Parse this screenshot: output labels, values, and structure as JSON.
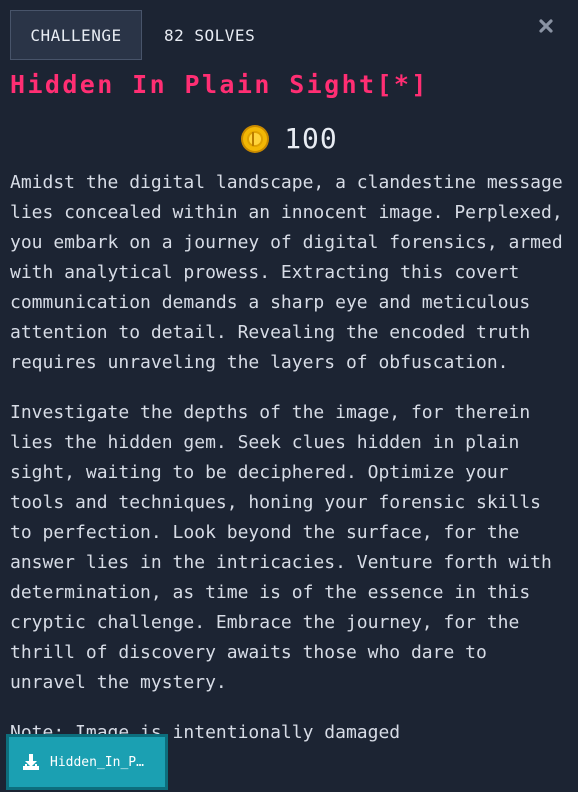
{
  "tabs": {
    "challenge": "CHALLENGE",
    "solves": "82 SOLVES"
  },
  "icons": {
    "close": "close-icon",
    "coin": "coin-icon",
    "download": "download-icon"
  },
  "colors": {
    "background": "#1c2433",
    "title": "#ff2e73",
    "button": "#1ba0b2",
    "coin": "#f2b705"
  },
  "challenge": {
    "title": "Hidden In Plain Sight[*]",
    "points": "100",
    "description": [
      "Amidst the digital landscape, a clandestine message lies concealed within an innocent image. Perplexed, you embark on a journey of digital forensics, armed with analytical prowess. Extracting this covert communication demands a sharp eye and meticulous attention to detail. Revealing the encoded truth requires unraveling the layers of obfuscation.",
      "Investigate the depths of the image, for therein lies the hidden gem. Seek clues hidden in plain sight, waiting to be deciphered. Optimize your tools and techniques, honing your forensic skills to perfection. Look beyond the surface, for the answer lies in the intricacies. Venture forth with determination, as time is of the essence in this cryptic challenge. Embrace the journey, for the thrill of discovery awaits those who dare to unravel the mystery.",
      "Note: Image is intentionally damaged"
    ],
    "file_label": "Hidden_In_P…"
  }
}
